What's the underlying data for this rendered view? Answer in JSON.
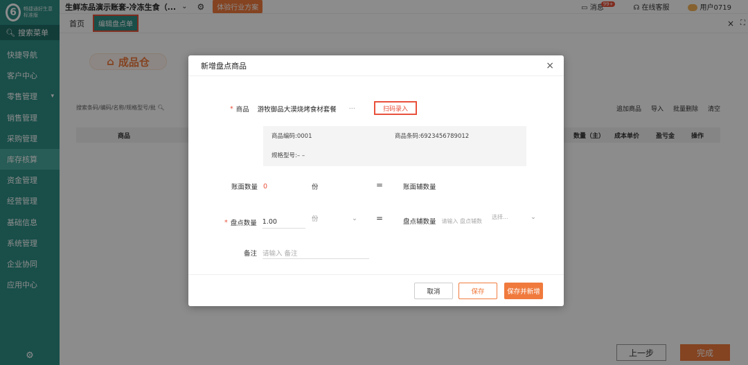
{
  "sidebar": {
    "logo_letter": "6",
    "logo_text_line1": "畅捷通好生意",
    "logo_text_line2": "标准版",
    "search_label": "搜索菜单",
    "items": [
      {
        "label": "快捷导航"
      },
      {
        "label": "客户中心"
      },
      {
        "label": "零售管理",
        "arrow": "▾"
      },
      {
        "label": "销售管理"
      },
      {
        "label": "采购管理"
      },
      {
        "label": "库存核算"
      },
      {
        "label": "资金管理"
      },
      {
        "label": "经营管理"
      },
      {
        "label": "基础信息"
      },
      {
        "label": "系统管理"
      },
      {
        "label": "企业协同"
      },
      {
        "label": "应用中心"
      }
    ]
  },
  "topbar": {
    "account": "生鲜冻品演示账套-冷冻生食（...",
    "plan_button": "体验行业方案",
    "messages": "消息",
    "message_badge": "99+",
    "support": "在线客服",
    "user": "用户0719"
  },
  "tabbar": {
    "home": "首页",
    "active_tab": "编辑盘点单",
    "close_all": "×",
    "expand": "⛶"
  },
  "background": {
    "warehouse": "成品仓",
    "search_placeholder": "搜索条码/编码/名称/规格型号/批",
    "table_head": [
      "商品",
      "数量（主）",
      "成本单价",
      "盈亏金",
      "操作"
    ],
    "actions": [
      "追加商品",
      "导入",
      "批量删除",
      "清空"
    ],
    "prev_step": "上一步",
    "done": "完成"
  },
  "modal": {
    "title": "新增盘点商品",
    "product_label": "商品",
    "product_value": "游牧御品大漠烧烤食材套餐",
    "dots": "···",
    "scan_button": "扫码录入",
    "product_code": "商品编码:0001",
    "product_barcode": "商品条码:6923456789012",
    "spec": "规格型号:– –",
    "book_qty_label": "账面数量",
    "book_qty_value": "0",
    "book_unit": "份",
    "book_aux_label": "账面辅数量",
    "count_qty_label": "盘点数量",
    "count_qty_value": "1.00",
    "count_unit": "份",
    "count_aux_label": "盘点辅数量",
    "count_aux_placeholder": "请输入 盘点辅数",
    "aux_unit_placeholder": "选择...",
    "note_label": "备注",
    "note_placeholder": "请输入 备注",
    "equals": "=",
    "cancel": "取消",
    "save": "保存",
    "save_new": "保存并新增"
  }
}
